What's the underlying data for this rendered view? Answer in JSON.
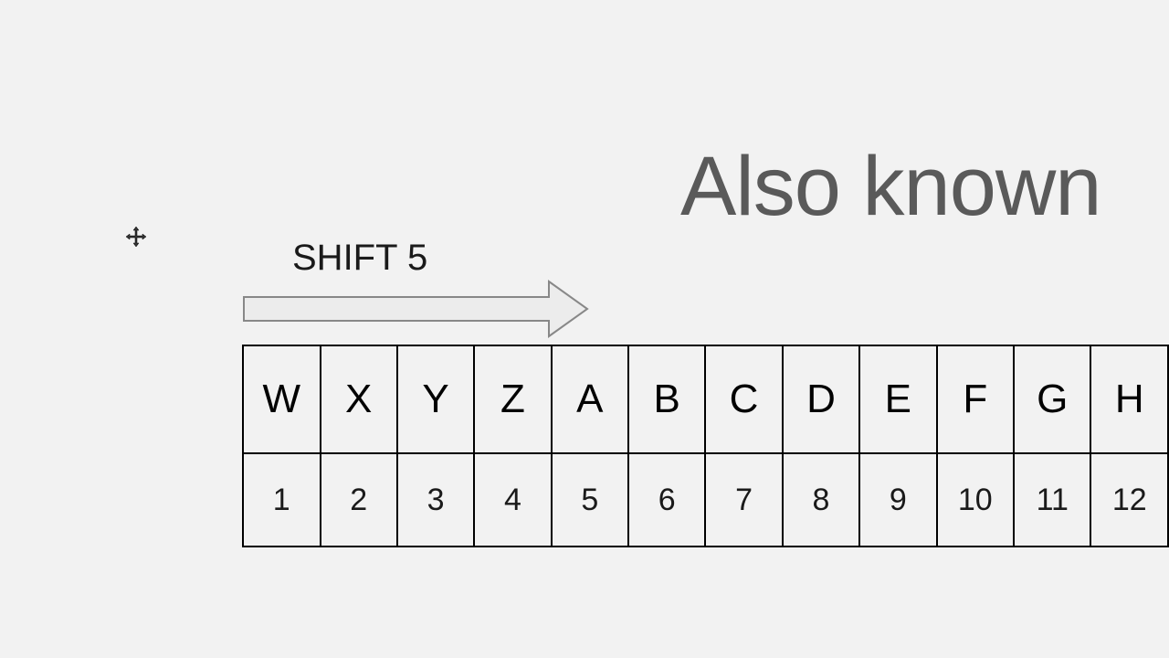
{
  "heading": "Also known",
  "shift_label": "SHIFT 5",
  "cipher": {
    "letters": [
      "W",
      "X",
      "Y",
      "Z",
      "A",
      "B",
      "C",
      "D",
      "E",
      "F",
      "G",
      "H"
    ],
    "numbers": [
      "1",
      "2",
      "3",
      "4",
      "5",
      "6",
      "7",
      "8",
      "9",
      "10",
      "11",
      "12"
    ]
  }
}
